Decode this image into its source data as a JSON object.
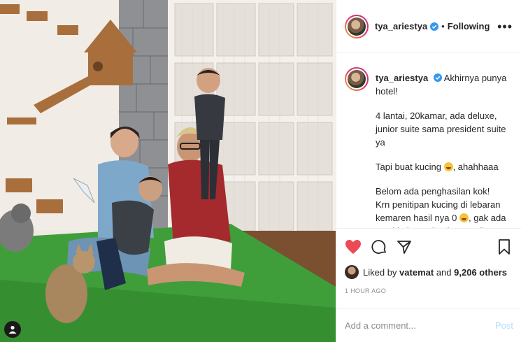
{
  "post": {
    "username": "tya_ariestya",
    "follow_status": "Following",
    "more_icon": "more-horizontal-icon",
    "caption_title": "Akhirnya punya hotel!",
    "caption_lines": [
      "4 lantai, 20kamar, ada deluxe, junior suite sama president suite ya",
      "Tapi buat kucing",
      ", ahahhaaa",
      "Belom ada penghasilan kok!",
      "Krn penitipan kucing di lebaran kemaren hasil nya 0",
      ", gak ada yg nitip krn gak ada yg pulkam"
    ],
    "liked_by_prefix": "Liked by",
    "liked_by_user": "vatemat",
    "liked_by_and": "and",
    "liked_by_others": "9,206 others",
    "timestamp": "1 HOUR AGO",
    "comment_placeholder": "Add a comment...",
    "post_button": "Post"
  },
  "icons": [
    "heart-icon",
    "comment-icon",
    "share-icon",
    "bookmark-icon",
    "verified-icon",
    "user-tag-icon"
  ],
  "colors": {
    "like_red": "#ed4956",
    "verified_blue": "#3897f0",
    "post_button_disabled": "#b2dffc",
    "muted_text": "#8e8e8e"
  }
}
